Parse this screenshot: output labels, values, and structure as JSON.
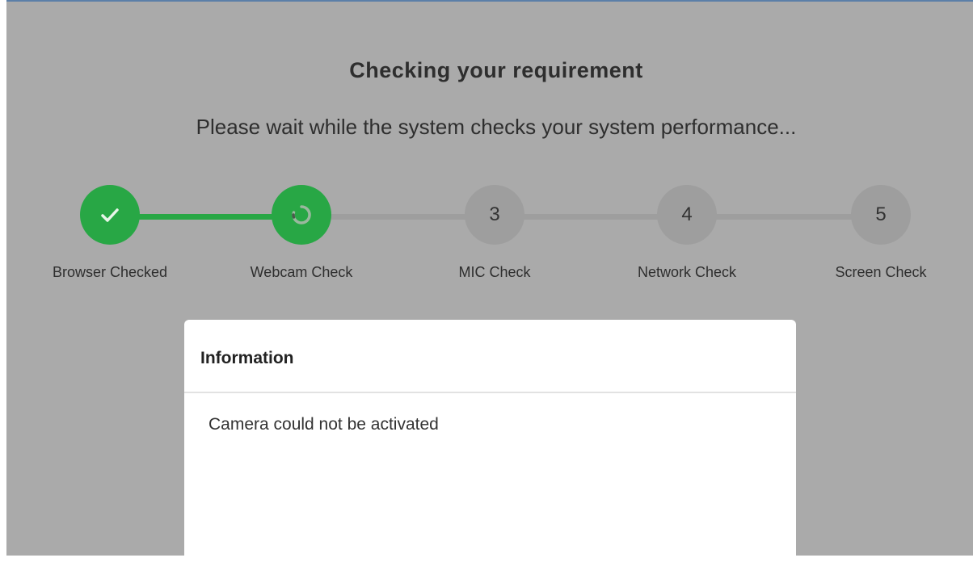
{
  "header": {
    "title": "Checking your requirement",
    "subtitle": "Please wait while the system checks your system performance..."
  },
  "steps": [
    {
      "number": "",
      "label": "Browser Checked",
      "status": "done",
      "icon": "check-icon"
    },
    {
      "number": "",
      "label": "Webcam Check",
      "status": "active",
      "icon": "loading-spinner-icon"
    },
    {
      "number": "3",
      "label": "MIC Check",
      "status": "pending"
    },
    {
      "number": "4",
      "label": "Network Check",
      "status": "pending"
    },
    {
      "number": "5",
      "label": "Screen Check",
      "status": "pending"
    }
  ],
  "modal": {
    "title": "Information",
    "message": "Camera could not be activated"
  },
  "colors": {
    "overlay": "#aaaaaa",
    "success": "#28a745",
    "pending": "#9e9e9e",
    "modal_bg": "#ffffff"
  }
}
